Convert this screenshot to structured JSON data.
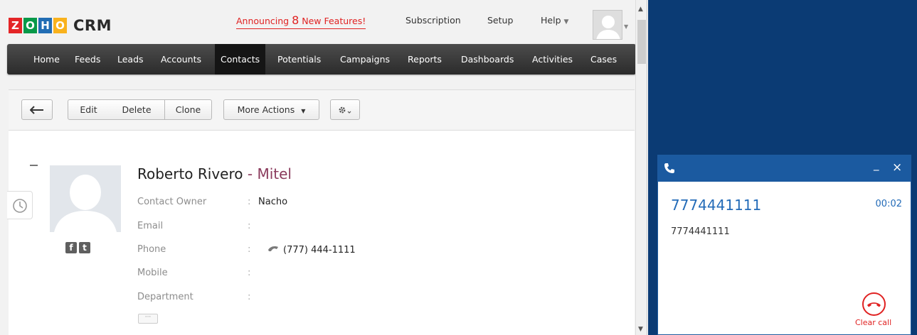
{
  "crm": {
    "logo": {
      "letters": [
        "Z",
        "O",
        "H",
        "O"
      ],
      "letter_colors": [
        "#e42527",
        "#089949",
        "#226db4",
        "#f9b21d"
      ],
      "product": "CRM"
    },
    "announcement": {
      "prefix": "Announcing ",
      "count": "8",
      "suffix": " New Features!"
    },
    "top_links": {
      "subscription": "Subscription",
      "setup": "Setup",
      "help": "Help"
    },
    "nav": [
      {
        "label": "Home"
      },
      {
        "label": "Feeds"
      },
      {
        "label": "Leads"
      },
      {
        "label": "Accounts"
      },
      {
        "label": "Contacts",
        "active": true
      },
      {
        "label": "Potentials"
      },
      {
        "label": "Campaigns"
      },
      {
        "label": "Reports"
      },
      {
        "label": "Dashboards"
      },
      {
        "label": "Activities"
      },
      {
        "label": "Cases"
      }
    ],
    "toolbar": {
      "back_icon": "arrow-left-icon",
      "edit": "Edit",
      "delete": "Delete",
      "clone": "Clone",
      "more_actions": "More Actions",
      "settings_icon": "gear-icon"
    },
    "contact": {
      "first_last": "Roberto Rivero",
      "separator": " - ",
      "company": "Mitel",
      "fields": [
        {
          "label": "Contact Owner",
          "value": "Nacho"
        },
        {
          "label": "Email",
          "value": ""
        },
        {
          "label": "Phone",
          "value": "(777) 444-1111"
        },
        {
          "label": "Mobile",
          "value": ""
        },
        {
          "label": "Department",
          "value": ""
        }
      ],
      "more_dots": "···"
    },
    "social": {
      "facebook": "f",
      "twitter": "t"
    }
  },
  "phone": {
    "header_icon": "phone-icon",
    "minimize": "_",
    "close": "×",
    "number": "7774441111",
    "timer": "00:02",
    "caller_id": "7774441111",
    "hangup_label": "Clear call",
    "accent": "#1b5aa0",
    "background": "#0b3b74",
    "hangup_color": "#e02222"
  }
}
